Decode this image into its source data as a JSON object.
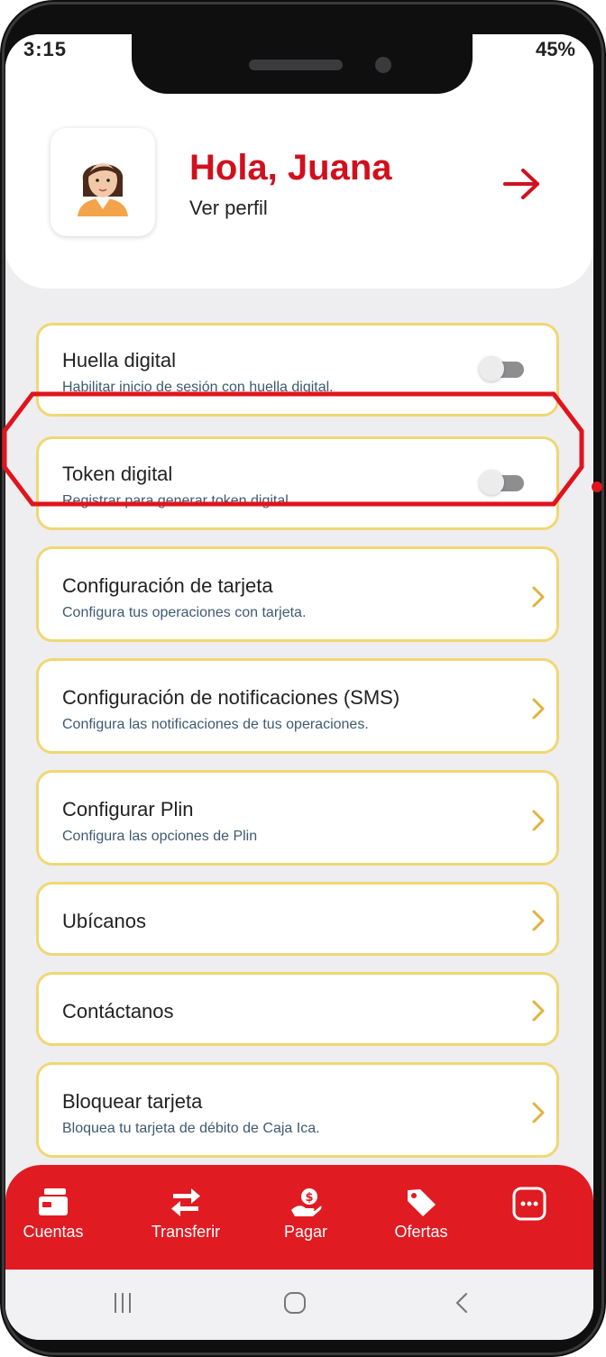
{
  "status_bar": {
    "time": "3:15",
    "battery": "45%"
  },
  "profile": {
    "greeting": "Hola, Juana",
    "link": "Ver perfil"
  },
  "settings": [
    {
      "title": "Huella digital",
      "subtitle": "Habilitar inicio de sesión con huella digital.",
      "control": "toggle",
      "enabled": false
    },
    {
      "title": "Token digital",
      "subtitle": "Registrar para generar token digital.",
      "control": "toggle",
      "enabled": false
    }
  ],
  "menu": [
    {
      "title": "Configuración de tarjeta",
      "subtitle": "Configura tus operaciones con tarjeta."
    },
    {
      "title": "Configuración de notificaciones (SMS)",
      "subtitle": "Configura las notificaciones de tus operaciones."
    },
    {
      "title": "Configurar Plin",
      "subtitle": "Configura las opciones de Plin"
    },
    {
      "title": "Ubícanos",
      "subtitle": ""
    },
    {
      "title": "Contáctanos",
      "subtitle": ""
    },
    {
      "title": "Bloquear tarjeta",
      "subtitle": "Bloquea tu tarjeta de débito de Caja Ica."
    }
  ],
  "bottom_nav": {
    "items": [
      {
        "label": "Cuentas",
        "icon": "cards-icon"
      },
      {
        "label": "Transferir",
        "icon": "transfer-arrows-icon"
      },
      {
        "label": "Pagar",
        "icon": "pay-hand-coin-icon"
      },
      {
        "label": "Ofertas",
        "icon": "tag-icon"
      }
    ],
    "more_icon": "more-dots-icon"
  },
  "colors": {
    "brand_red": "#e01b22",
    "greeting_red": "#d0101e",
    "card_border": "#f0d774",
    "chevron": "#e0b43c",
    "highlight": "#e0141c"
  }
}
